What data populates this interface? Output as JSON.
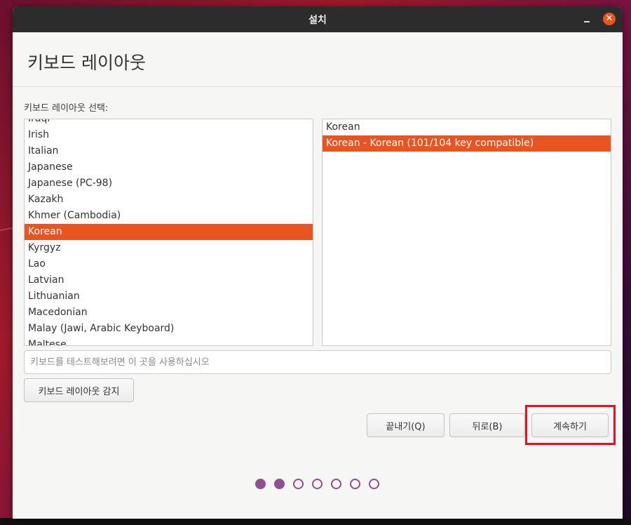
{
  "window": {
    "title": "설치"
  },
  "page": {
    "heading": "키보드 레이아웃"
  },
  "layout_select": {
    "label": "키보드 레이아웃 선택:",
    "layouts": [
      "Iraqi",
      "Irish",
      "Italian",
      "Japanese",
      "Japanese (PC-98)",
      "Kazakh",
      "Khmer (Cambodia)",
      "Korean",
      "Kyrgyz",
      "Lao",
      "Latvian",
      "Lithuanian",
      "Macedonian",
      "Malay (Jawi, Arabic Keyboard)",
      "Maltese"
    ],
    "selected_layout": "Korean",
    "variants": [
      "Korean",
      "Korean - Korean (101/104 key compatible)"
    ],
    "selected_variant": "Korean - Korean (101/104 key compatible)"
  },
  "test_field": {
    "placeholder": "키보드를 테스트해보려면 이 곳을 사용하십시오",
    "value": ""
  },
  "buttons": {
    "detect": "키보드 레이아웃 감지",
    "quit": "끝내기(Q)",
    "back": "뒤로(B)",
    "continue": "계속하기"
  },
  "progress": {
    "total_steps": 7,
    "current_step": 2
  },
  "colors": {
    "accent": "#e95420",
    "highlight_box": "#e8111f",
    "progress_dot": "#8f4f91"
  }
}
